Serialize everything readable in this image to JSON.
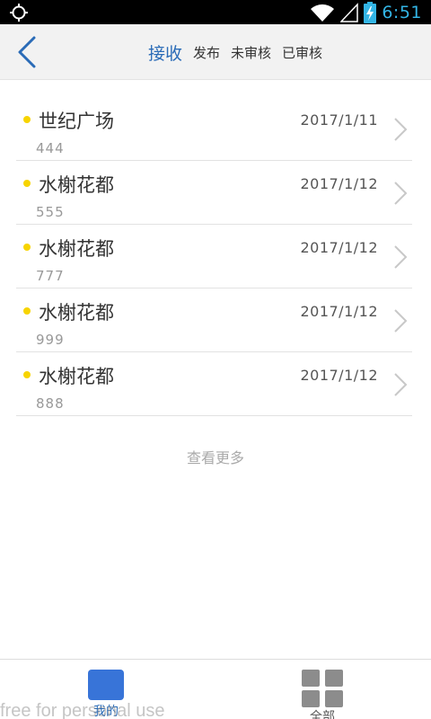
{
  "status_bar": {
    "time": "6:51",
    "icons": [
      "gps-icon",
      "wifi-icon",
      "signal-icon",
      "battery-charging-icon"
    ]
  },
  "header": {
    "back_icon": "chevron-left-icon",
    "tabs": [
      {
        "label": "接收",
        "active": true
      },
      {
        "label": "发布",
        "active": false
      },
      {
        "label": "未审核",
        "active": false
      },
      {
        "label": "已审核",
        "active": false
      }
    ]
  },
  "list": {
    "items": [
      {
        "title": "世纪广场",
        "date": "2017/1/11",
        "sub": "444"
      },
      {
        "title": "水榭花都",
        "date": "2017/1/12",
        "sub": "555"
      },
      {
        "title": "水榭花都",
        "date": "2017/1/12",
        "sub": "777"
      },
      {
        "title": "水榭花都",
        "date": "2017/1/12",
        "sub": "999"
      },
      {
        "title": "水榭花都",
        "date": "2017/1/12",
        "sub": "888"
      }
    ],
    "more_label": "查看更多"
  },
  "bottom_nav": {
    "items": [
      {
        "label": "我的",
        "icon": "square-icon",
        "active": true
      },
      {
        "label": "全部",
        "icon": "grid-icon",
        "active": false
      }
    ]
  },
  "watermark": "free for personal use",
  "colors": {
    "accent": "#2a6bb7",
    "active_nav": "#3874d8",
    "dot": "#f7d400",
    "status_time": "#33b5e5"
  }
}
